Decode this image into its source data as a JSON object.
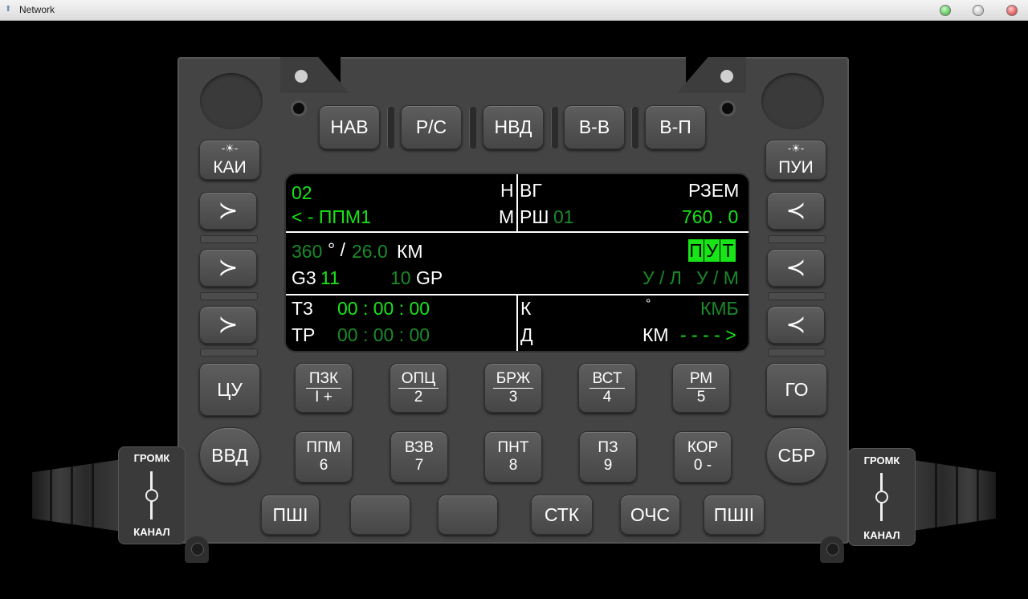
{
  "window": {
    "title": "Network"
  },
  "top_buttons": [
    "НАВ",
    "Р/С",
    "НВД",
    "В-В",
    "В-П"
  ],
  "left_labels": {
    "kai": "КАИ",
    "tsu": "ЦУ",
    "vvd": "ВВД"
  },
  "right_labels": {
    "pui": "ПУИ",
    "go": "ГО",
    "sbr": "СБР"
  },
  "screen": {
    "r1_left": "02",
    "r1_n": "Н",
    "r1_vg": "ВГ",
    "r1_right": "РЗЕМ",
    "r2_left": "< - ППМ1",
    "r2_m": "М",
    "r2_rsh": "РШ",
    "r2_rsh_val": "01",
    "r2_right": "760 . 0",
    "r3_deg": "360",
    "r3_slash": "° /",
    "r3_dist": "26.0",
    "r3_km": "КМ",
    "put": [
      "П",
      "У",
      "Т"
    ],
    "r4_g3": "G3",
    "r4_g3_val": "11",
    "r4_gr_val": "10",
    "r4_gr": "GP",
    "r4_ul": "У / Л",
    "r4_um": "У / М",
    "r5_t3": "Т3",
    "r5_time": "00 : 00 : 00",
    "r5_k": "К",
    "r5_deg": "°",
    "r5_kmb": "КМБ",
    "r6_tr": "ТР",
    "r6_time": "00 : 00 : 00",
    "r6_d": "Д",
    "r6_km": "КМ",
    "r6_arrow": "- - - - >"
  },
  "keypad_row1": [
    {
      "top": "ПЗК",
      "bottom": "I +"
    },
    {
      "top": "ОПЦ",
      "bottom": "2"
    },
    {
      "top": "БРЖ",
      "bottom": "3"
    },
    {
      "top": "ВСТ",
      "bottom": "4"
    },
    {
      "top": "РМ",
      "bottom": "5"
    }
  ],
  "keypad_row2": [
    {
      "top": "ППМ",
      "bottom": "6"
    },
    {
      "top": "ВЗВ",
      "bottom": "7"
    },
    {
      "top": "ПНТ",
      "bottom": "8"
    },
    {
      "top": "ПЗ",
      "bottom": "9"
    },
    {
      "top": "КОР",
      "bottom": "0 -"
    }
  ],
  "bottom_buttons": [
    "ПШI",
    "",
    "",
    "СТК",
    "ОЧС",
    "ПШII"
  ],
  "knob_left": {
    "top": "ГРОМК",
    "bottom": "КАНАЛ"
  },
  "knob_right": {
    "top": "ГРОМК",
    "bottom": "КАНАЛ"
  },
  "icons": {
    "left_arrows": "chevron-right-icon",
    "right_arrows": "chevron-left-icon",
    "kai_star": "light-icon",
    "window_close": "close-icon"
  },
  "colors": {
    "panel": "#444444",
    "screen_text_green": "#17e517",
    "screen_text_dim": "#1a8a2a",
    "put_bg": "#17e517"
  }
}
